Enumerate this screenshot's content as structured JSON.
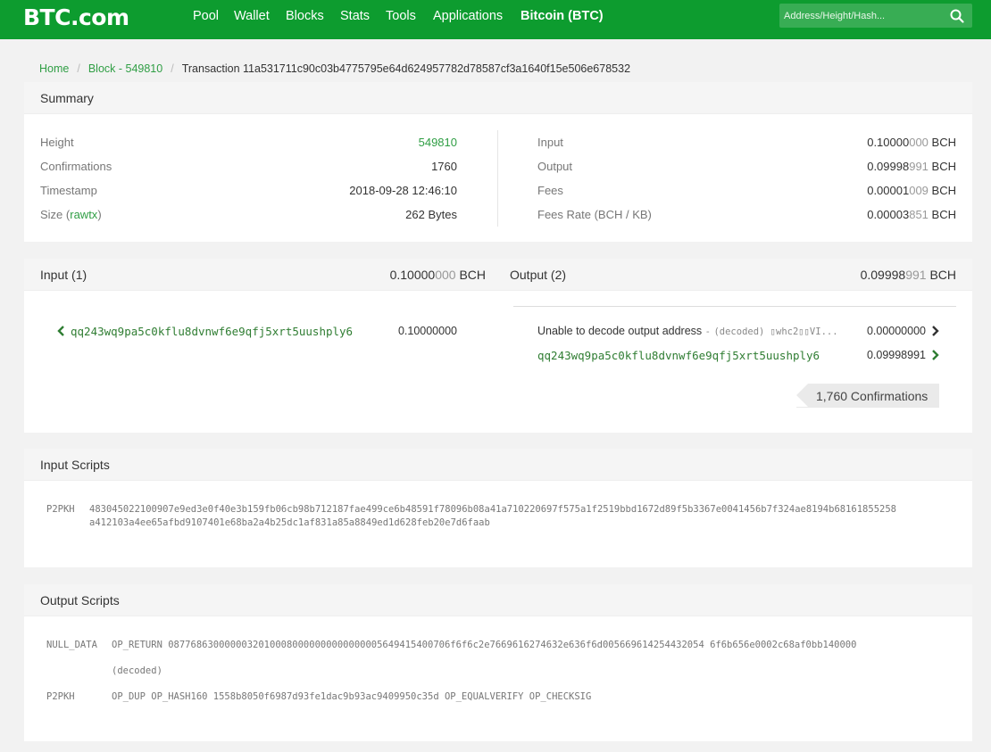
{
  "nav": {
    "logo": "BTC.com",
    "items": [
      "Pool",
      "Wallet",
      "Blocks",
      "Stats",
      "Tools",
      "Applications",
      "Bitcoin (BTC)"
    ],
    "search_placeholder": "Address/Height/Hash..."
  },
  "breadcrumb": {
    "home": "Home",
    "block": "Block - 549810",
    "current": "Transaction 11a531711c90c03b4775795e64d624957782d78587cf3a1640f15e506e678532"
  },
  "summary": {
    "title": "Summary",
    "left": [
      {
        "label": "Height",
        "value": "549810"
      },
      {
        "label": "Confirmations",
        "value": "1760"
      },
      {
        "label": "Timestamp",
        "value": "2018-09-28 12:46:10"
      },
      {
        "label": "Size",
        "label_link": "rawtx",
        "value": "262 Bytes"
      }
    ],
    "right": [
      {
        "label": "Input",
        "value_main": "0.10000",
        "value_dim": "000",
        "unit": "BCH"
      },
      {
        "label": "Output",
        "value_main": "0.09998",
        "value_dim": "991",
        "unit": "BCH"
      },
      {
        "label": "Fees",
        "value_main": "0.00001",
        "value_dim": "009",
        "unit": "BCH"
      },
      {
        "label": "Fees Rate (BCH / KB)",
        "value_main": "0.00003",
        "value_dim": "851",
        "unit": "BCH"
      }
    ]
  },
  "io": {
    "input_title": "Input (1)",
    "input_total_main": "0.10000",
    "input_total_dim": "000",
    "input_total_unit": "BCH",
    "output_title": "Output (2)",
    "output_total_main": "0.09998",
    "output_total_dim": "991",
    "output_total_unit": "BCH",
    "inputs": [
      {
        "address": "qq243wq9pa5c0kflu8dvnwf6e9qfj5xrt5uushply6",
        "amount": "0.10000000"
      }
    ],
    "outputs": [
      {
        "label": "Unable to decode output address",
        "dash": "-",
        "decoded": "(decoded) ▯whc2▯▯VI...",
        "amount": "0.00000000"
      },
      {
        "address": "qq243wq9pa5c0kflu8dvnwf6e9qfj5xrt5uushply6",
        "amount": "0.09998991"
      }
    ],
    "confirmations_badge": "1,760 Confirmations"
  },
  "input_scripts": {
    "title": "Input Scripts",
    "rows": [
      {
        "type": "P2PKH",
        "line1": "483045022100907e9ed3e0f40e3b159fb06cb98b712187fae499ce6b48591f78096b08a41a710220697f575a1f2519bbd1672d89f5b3367e0041456b7f324ae8194b68161855258",
        "line2": "a412103a4ee65afbd9107401e68ba2a4b25dc1af831a85a8849ed1d628feb20e7d6faab"
      }
    ]
  },
  "output_scripts": {
    "title": "Output Scripts",
    "rows": [
      {
        "type": "NULL_DATA",
        "text": "OP_RETURN 08776863000000320100080000000000000005649415400706f6f6c2e7669616274632e636f6d005669614254432054 6f6b656e0002c68af0bb140000"
      },
      {
        "type": "",
        "text": "(decoded)"
      },
      {
        "type": "P2PKH",
        "text": "OP_DUP OP_HASH160 1558b8050f6987d93fe1dac9b93ac9409950c35d OP_EQUALVERIFY OP_CHECKSIG"
      }
    ]
  },
  "colors": {
    "nav_bg": "#0d9c2f",
    "link": "#2f9e44",
    "address": "#2f7d32"
  }
}
